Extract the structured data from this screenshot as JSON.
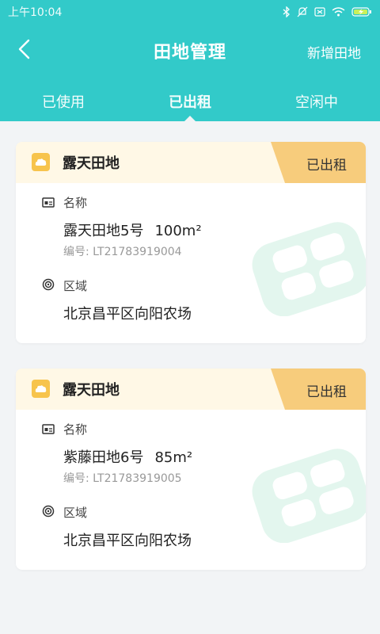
{
  "status_bar": {
    "time": "上午10:04",
    "icons": [
      "bluetooth-icon",
      "mute-icon",
      "sim-icon",
      "wifi-icon",
      "battery-charging-icon"
    ]
  },
  "header": {
    "back_icon": "chevron-left-icon",
    "title": "田地管理",
    "action": "新增田地"
  },
  "tabs": [
    {
      "label": "已使用",
      "active": false
    },
    {
      "label": "已出租",
      "active": true
    },
    {
      "label": "空闲中",
      "active": false
    }
  ],
  "colors": {
    "primary": "#32cac9",
    "header_bg": "#fff8e6",
    "badge": "#f7cc7c",
    "icon_yellow": "#f7c44d",
    "watermark": "#e3f6ee"
  },
  "fields": {
    "name_label": "名称",
    "region_label": "区域"
  },
  "cards": [
    {
      "type": "露天田地",
      "status": "已出租",
      "name": "露天田地5号",
      "area": "100m²",
      "code": "编号: LT21783919004",
      "region": "北京昌平区向阳农场"
    },
    {
      "type": "露天田地",
      "status": "已出租",
      "name": "紫藤田地6号",
      "area": "85m²",
      "code": "编号: LT21783919005",
      "region": "北京昌平区向阳农场"
    }
  ]
}
